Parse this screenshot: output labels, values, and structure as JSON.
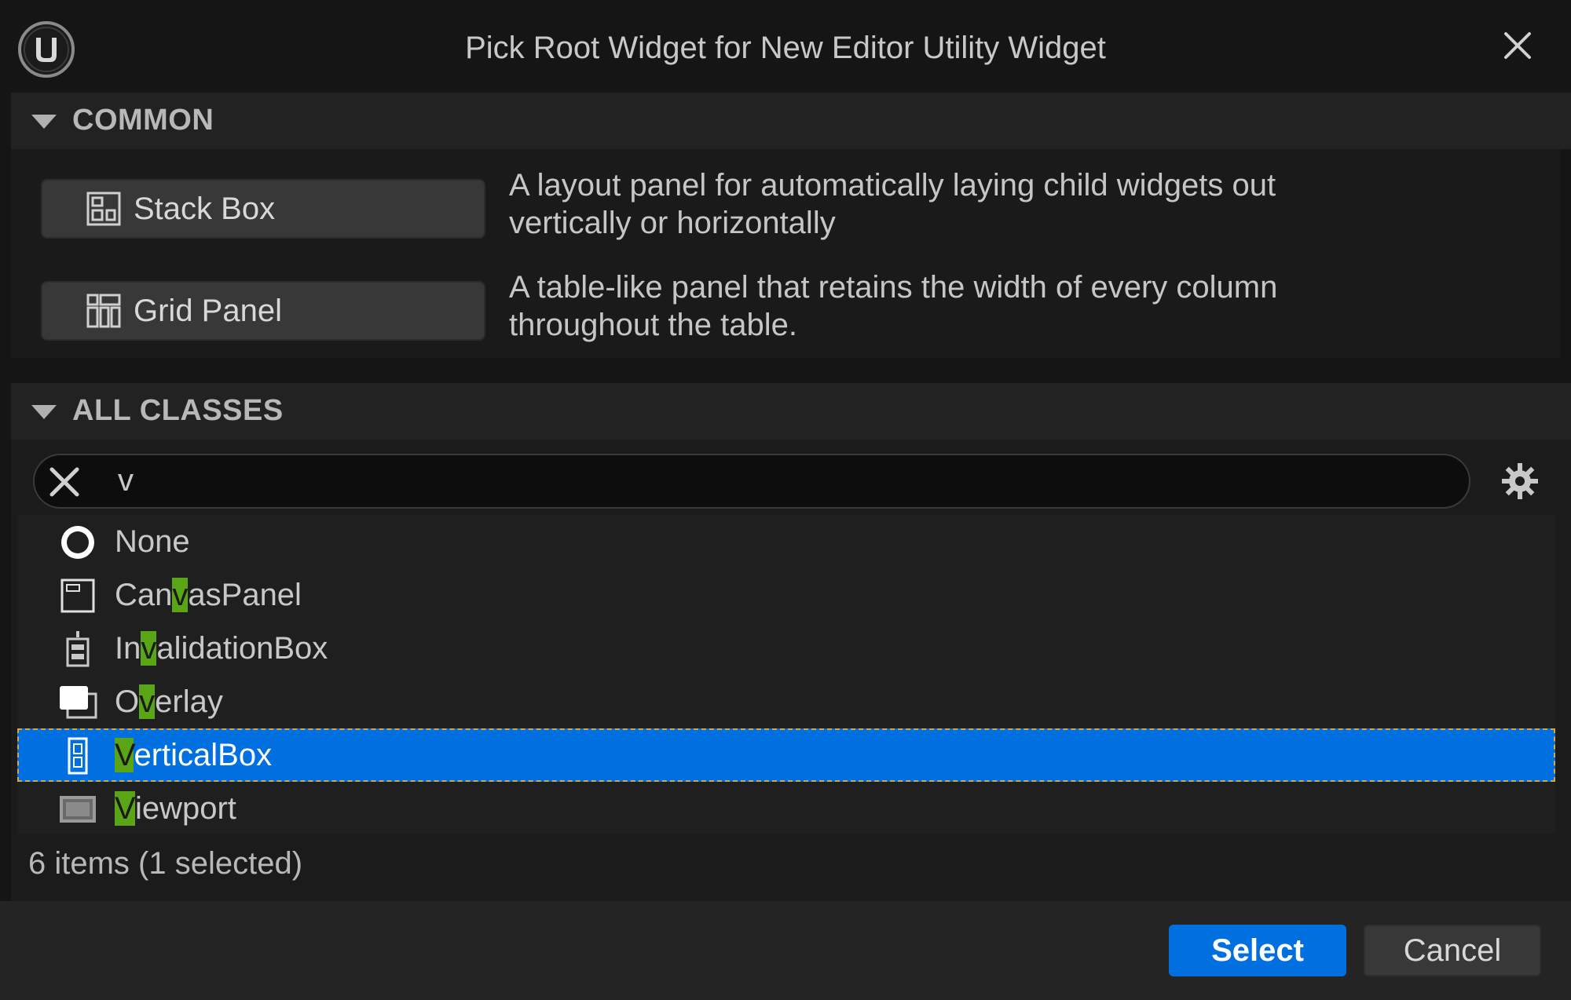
{
  "window": {
    "title": "Pick Root Widget for New Editor Utility Widget",
    "logo_icon": "unreal-logo-icon",
    "close_icon": "close-icon"
  },
  "common": {
    "header": "COMMON",
    "items": [
      {
        "label": "Stack Box",
        "icon": "stack-box-icon",
        "description_line1": "A layout panel for automatically laying child widgets out",
        "description_line2": "vertically or horizontally"
      },
      {
        "label": "Grid Panel",
        "icon": "grid-panel-icon",
        "description_line1": "A table-like panel that retains the width of every column",
        "description_line2": "throughout the table."
      }
    ]
  },
  "all_classes": {
    "header": "ALL CLASSES",
    "search": {
      "value": "v",
      "clear_icon": "clear-icon",
      "settings_icon": "gear-icon"
    },
    "items": [
      {
        "pre": "None",
        "match": "",
        "post": "",
        "icon": "none-icon",
        "selected": false
      },
      {
        "pre": "Can",
        "match": "v",
        "post": "asPanel",
        "icon": "canvas-panel-icon",
        "selected": false
      },
      {
        "pre": "In",
        "match": "v",
        "post": "alidationBox",
        "icon": "invalidation-box-icon",
        "selected": false
      },
      {
        "pre": "O",
        "match": "v",
        "post": "erlay",
        "icon": "overlay-icon",
        "selected": false
      },
      {
        "pre": "",
        "match": "V",
        "post": "erticalBox",
        "icon": "vertical-box-icon",
        "selected": true
      },
      {
        "pre": "",
        "match": "V",
        "post": "iewport",
        "icon": "viewport-icon",
        "selected": false
      }
    ],
    "status": "6 items (1 selected)"
  },
  "footer": {
    "select_label": "Select",
    "cancel_label": "Cancel"
  },
  "colors": {
    "accent": "#0070e0",
    "match_highlight": "#5aa515",
    "selection_outline": "#d9a640",
    "background": "#151515"
  }
}
